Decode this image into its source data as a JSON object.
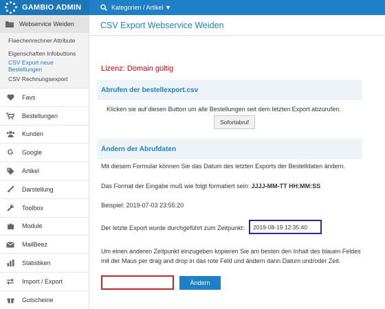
{
  "topbar": {
    "brand": "GAMBIO ADMIN",
    "nav_label": "Kategorien / Artikel ▼"
  },
  "sidebar": {
    "active_section": "Webservice Weiden",
    "sub_items": [
      {
        "label": "Flaechenrechner Attribute",
        "active": false
      },
      {
        "label": "Eigenschaften Infobuttons",
        "active": false
      },
      {
        "label": "CSV Export neue Bestellungen",
        "active": true
      },
      {
        "label": "CSV Rechnungsexport",
        "active": false
      }
    ],
    "menu": [
      {
        "label": "Favs",
        "icon": "heart-icon"
      },
      {
        "label": "Bestellungen",
        "icon": "cart-icon"
      },
      {
        "label": "Kunden",
        "icon": "users-icon"
      },
      {
        "label": "Google",
        "icon": "google-icon"
      },
      {
        "label": "Artikel",
        "icon": "tag-icon"
      },
      {
        "label": "Darstellung",
        "icon": "brush-icon"
      },
      {
        "label": "Toolbox",
        "icon": "wrench-icon"
      },
      {
        "label": "Module",
        "icon": "puzzle-icon"
      },
      {
        "label": "MailBeez",
        "icon": "mail-icon"
      },
      {
        "label": "Statistiken",
        "icon": "chart-icon"
      },
      {
        "label": "Import / Export",
        "icon": "exchange-icon"
      },
      {
        "label": "Gutscheine",
        "icon": "gift-icon"
      }
    ]
  },
  "main": {
    "title": "CSV Export Webservice Weiden",
    "license": "Lizenz: Domain gültig",
    "fetch_section": {
      "heading": "Abrufen der bestellexport.csv",
      "description": "Klicken sie auf diesen Button um alle Bestellungen seit dem letzten Export abzurufen.",
      "button": "Sofortabruf"
    },
    "change_section": {
      "heading": "Ändern der Abrufdaten",
      "intro": "Mit diesem Formular können Sie das Datum des letzten Exports der Bestelldaten ändern.",
      "format_prefix": "Das Format der Eingabe muß wie folgt formatiert sein: ",
      "format_value": "JJJJ-MM-TT HH:MM:SS",
      "example": "Beispiel: 2019-07-03 23:55:20",
      "last_export_label": "Der letzte Export wurde durchgeführt zum Zeitpunkt:",
      "last_export_value": "2019-08-19 12:35:40",
      "instructions_line1": "Um einen anderen Zeitpunkt einzugeben kopieren Sie am besten den Inhalt des blauen Feldes",
      "instructions_line2": "mit der Maus per drag and drop in das rote Feld und ändern dann Datum und/oder Zeit.",
      "new_value": "",
      "submit_button": "Ändern"
    }
  },
  "colors": {
    "accent": "#1f80c8",
    "license": "#d8000c",
    "blue_field_border": "#2a2a96",
    "red_field_border": "#c0272d"
  }
}
